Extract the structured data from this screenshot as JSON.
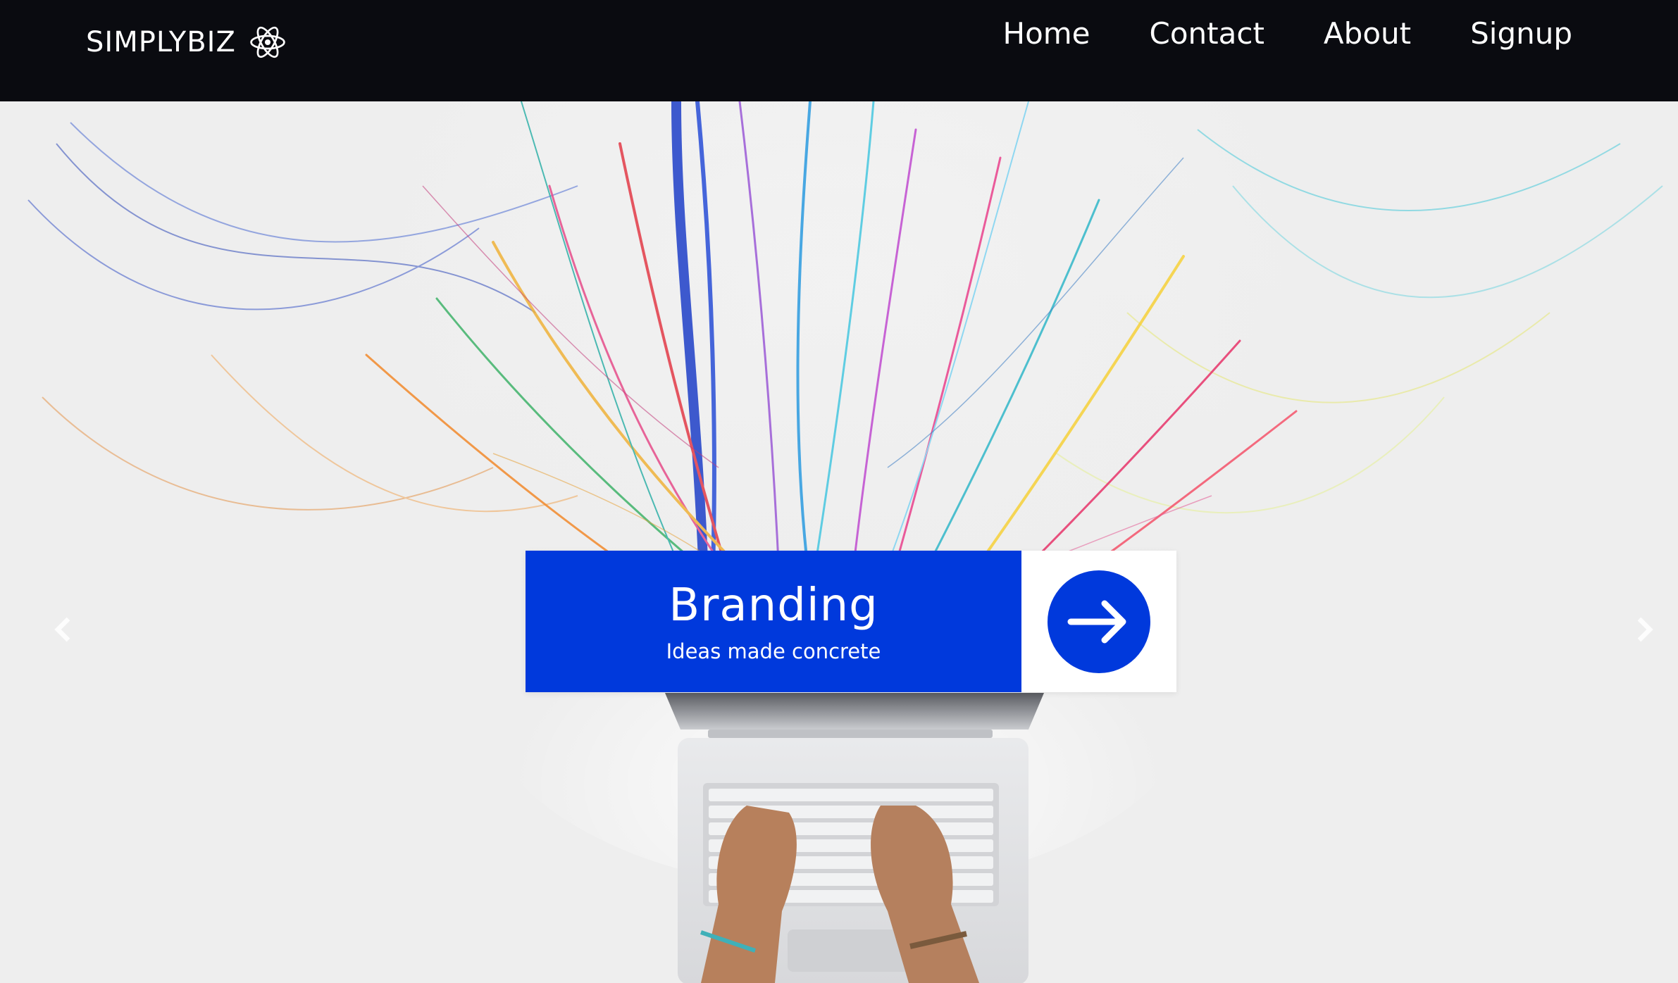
{
  "brand": {
    "name": "SIMPLYBIZ",
    "icon": "atom-icon"
  },
  "nav": {
    "items": [
      {
        "label": "Home"
      },
      {
        "label": "Contact"
      },
      {
        "label": "About"
      },
      {
        "label": "Signup"
      }
    ]
  },
  "hero": {
    "title": "Branding",
    "subtitle": "Ideas made concrete",
    "prev_icon": "chevron-left-icon",
    "next_icon": "chevron-right-icon",
    "cta_icon": "arrow-right-icon"
  },
  "colors": {
    "navbar": "#0a0b10",
    "accent": "#0039dc",
    "text_light": "#ffffff"
  }
}
